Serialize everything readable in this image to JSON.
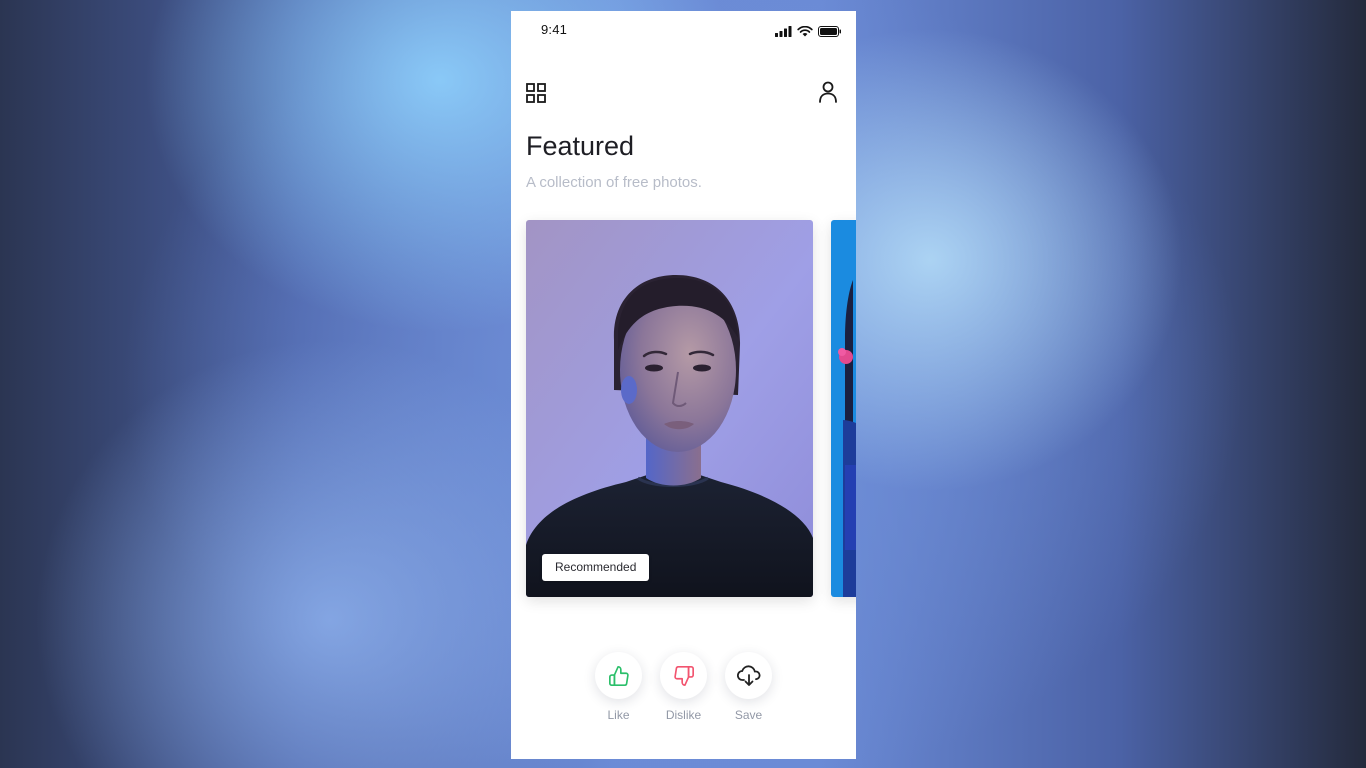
{
  "status_bar": {
    "time": "9:41"
  },
  "header": {
    "menu_icon": "grid-icon",
    "profile_icon": "user-icon"
  },
  "page": {
    "title": "Featured",
    "subtitle": "A collection of free photos."
  },
  "cards": [
    {
      "badge": "Recommended"
    }
  ],
  "actions": [
    {
      "label": "Like",
      "icon": "thumbs-up-icon",
      "color": "#2bbf6a"
    },
    {
      "label": "Dislike",
      "icon": "thumbs-down-icon",
      "color": "#f2546f"
    },
    {
      "label": "Save",
      "icon": "cloud-download-icon",
      "color": "#222222"
    }
  ],
  "colors": {
    "title": "#1e1e24",
    "subtitle": "#b7bcc8",
    "label": "#9298a6"
  }
}
